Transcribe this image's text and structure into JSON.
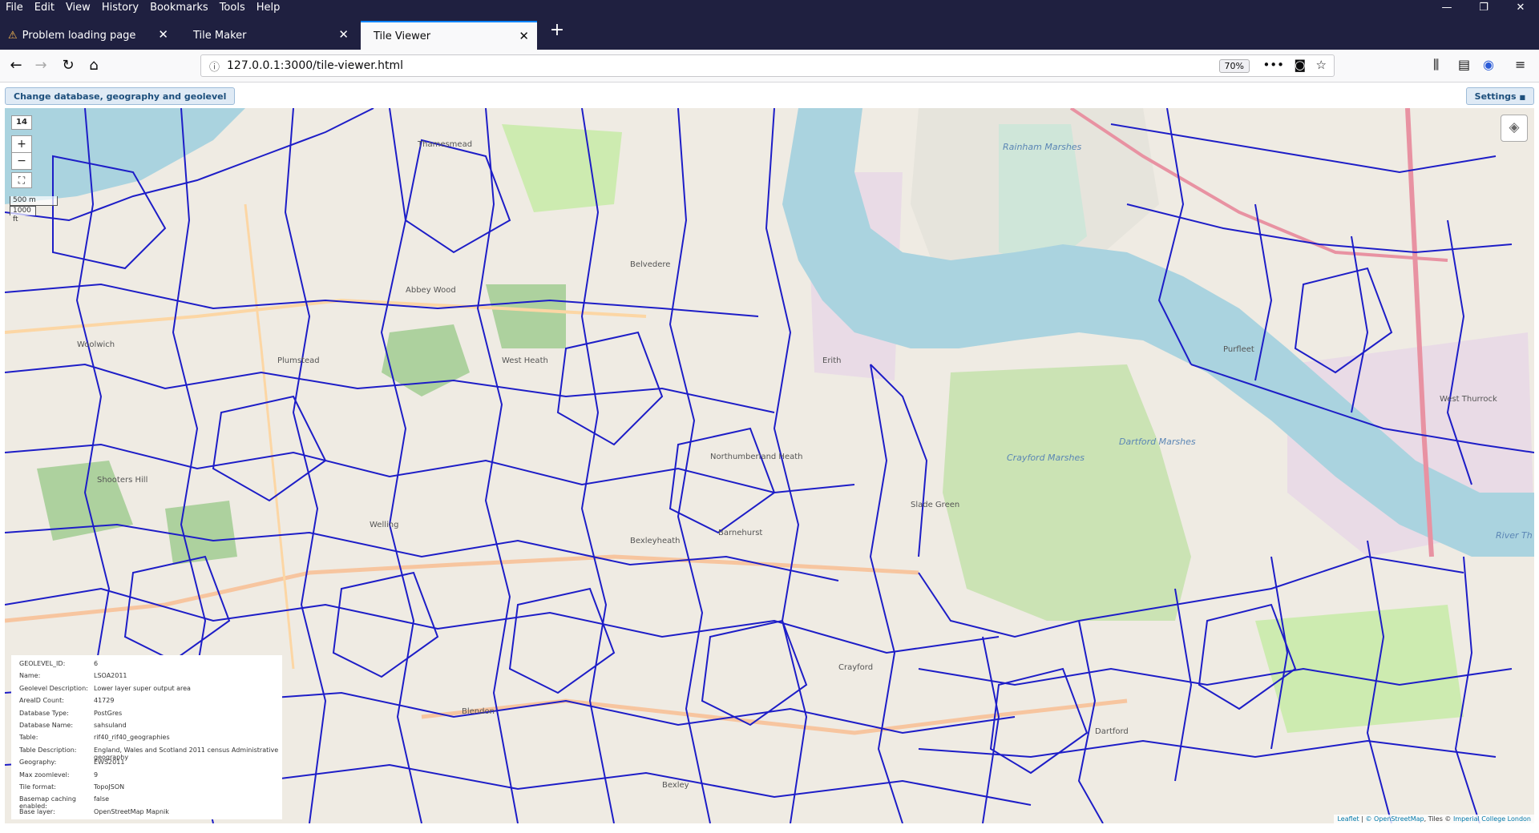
{
  "menubar": {
    "items": [
      "File",
      "Edit",
      "View",
      "History",
      "Bookmarks",
      "Tools",
      "Help"
    ],
    "minimize": "—",
    "restore": "❐",
    "close": "✕"
  },
  "tabs": [
    {
      "label": "Problem loading page",
      "icon": "warning-icon"
    },
    {
      "label": "Tile Maker"
    },
    {
      "label": "Tile Viewer",
      "active": true
    }
  ],
  "new_tab": "+",
  "navbar": {
    "url": "127.0.0.1:3000/tile-viewer.html",
    "zoom": "70%",
    "page_actions": "•••"
  },
  "app": {
    "change_button": "Change database, geography and geolevel",
    "settings_button": "Settings"
  },
  "map_controls": {
    "zoom_level": "14",
    "zoom_in": "+",
    "zoom_out": "−",
    "fullscreen": "⛶",
    "scale_m": "500 m",
    "scale_ft": "1000 ft"
  },
  "place_labels": [
    "Woolwich",
    "Plumstead",
    "Abbey Wood",
    "Thamesmead",
    "Belvedere",
    "West Heath",
    "Erith",
    "Northumberland Heath",
    "Welling",
    "Bexleyheath",
    "Barnehurst",
    "Crayford",
    "Dartford",
    "Bexley",
    "Purfleet",
    "West Thurrock",
    "Shooters Hill",
    "Blendon",
    "Slade Green"
  ],
  "water_labels": [
    "Rainham Marshes",
    "Crayford Marshes",
    "Dartford Marshes",
    "River Th"
  ],
  "info": {
    "rows": [
      {
        "k": "GEOLEVEL_ID:",
        "v": "6"
      },
      {
        "k": "Name:",
        "v": "LSOA2011"
      },
      {
        "k": "Geolevel Description:",
        "v": "Lower layer super output area"
      },
      {
        "k": "AreaID Count:",
        "v": "41729"
      },
      {
        "k": "Database Type:",
        "v": "PostGres"
      },
      {
        "k": "Database Name:",
        "v": "sahsuland"
      },
      {
        "k": "Table:",
        "v": "rif40_rif40_geographies"
      },
      {
        "k": "Table Description:",
        "v": "England, Wales and Scotland 2011 census Administrative geography"
      },
      {
        "k": "Geography:",
        "v": "EWS2011"
      },
      {
        "k": "Max zoomlevel:",
        "v": "9"
      },
      {
        "k": "Tile format:",
        "v": "TopoJSON"
      },
      {
        "k": "Basemap caching enabled:",
        "v": "false"
      },
      {
        "k": "Base layer:",
        "v": "OpenStreetMap Mapnik"
      }
    ]
  },
  "attribution": {
    "leaflet": "Leaflet",
    "osm": "© OpenStreetMap",
    "tiles": "Tiles ©",
    "icl": "Imperial College London"
  }
}
